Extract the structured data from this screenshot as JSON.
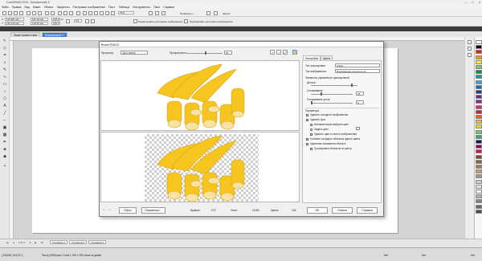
{
  "app": {
    "title": "CorelDRAW 2018 - Безымянный-1*",
    "menu": [
      "Файл",
      "Правка",
      "Вид",
      "Макет",
      "Объект",
      "Эффекты",
      "Растровые изображения",
      "Текст",
      "Таблица",
      "Инструменты",
      "Окно",
      "Справка"
    ],
    "zoom": "75%",
    "snap_label": "Привязать к",
    "start_label": "Запуск"
  },
  "toolbar2": {
    "x_label": "X:",
    "x_value": "110,381 мм",
    "y_label": "Y:",
    "y_value": "110,133 мм",
    "w_value": "187,23 мм",
    "h_value": "110,92 мм",
    "scale_w": "100,0",
    "scale_h": "100,0",
    "pct": "%",
    "angle": "0,0",
    "edit_bitmap": "Редактировать растровое изображение",
    "trace_bitmap": "Трассировать растровое изображение"
  },
  "tabs": [
    "Экран приветствия",
    "Безымянный-1*"
  ],
  "dialog": {
    "title": "PowerTRACE",
    "preview_label": "Просмотр:",
    "preview_mode": "До и после",
    "transparency_label": "Прозрачность:",
    "transparency_value": "50",
    "stats": {
      "curves_label": "Кривые:",
      "curves_value": "272",
      "nodes_label": "Узлы:",
      "nodes_value": "11183",
      "colors_label": "Цвета:",
      "colors_value": "134"
    },
    "buttons": {
      "reset": "Сброс",
      "options": "Параметры...",
      "ok": "OK",
      "cancel": "Отмена",
      "help": "Справка"
    },
    "settings": {
      "tabs": [
        "Настройки",
        "Цвета"
      ],
      "trace_type_label": "Тип трассировки:",
      "trace_type_value": "Абрис",
      "image_type_label": "Тип изображения:",
      "image_type_value": "Изображение высокого ка...",
      "controls_header": "Элементы управления трассировкой",
      "detail_label": "Детали",
      "smoothing_label": "Сглаживание",
      "smoothing_value": "25",
      "corner_label": "Сглаживание углов",
      "corner_value": "0",
      "params_header": "Параметры",
      "delete_original": "Удалить исходное изображение",
      "remove_bg": "Удалить фон",
      "auto_color": "Автоматически выбрать цвет",
      "set_color": "Задать цвет",
      "remove_all": "Удалить цвет из всего изображения",
      "merge_adjacent": "Слияние соседних объектов одного цвета",
      "remove_overlap": "Удаление наложения объекта",
      "group_by_color": "Группировка объектов по цвету"
    }
  },
  "pages": [
    "Страница 1",
    "Страница 2",
    "Страница 3"
  ],
  "page_counter": "1 из 1",
  "status": {
    "coords": "(-95,835; 243,071 )",
    "info": "Растр (RGB) вкл. Слой 1 199 x 199 точек на дюйм",
    "fill_none": "Нет",
    "outline_none": "Нет",
    "fill_none2": "Нет"
  },
  "colors": {
    "accent": "#3d7fd6",
    "banana": "#f6c51f",
    "banana_dark": "#d9a215",
    "cut": "#f8e3a4"
  },
  "palette": [
    "#ffffff",
    "#000000",
    "#e31c23",
    "#f7931e",
    "#fcee21",
    "#8cc63f",
    "#009245",
    "#00a99d",
    "#29abe2",
    "#0071bc",
    "#2e3192",
    "#662d91",
    "#93278f",
    "#ed1e79",
    "#c1272d",
    "#f15a24",
    "#fbb03b",
    "#d9e021",
    "#7ac943",
    "#22b573",
    "#1b1464",
    "#9e005d",
    "#d4145a",
    "#754c24",
    "#8c6239",
    "#a67c52",
    "#c69c6d",
    "#999999",
    "#cccccc",
    "#e6e6e6",
    "#f2f2f2",
    "#b3b3b3",
    "#808080",
    "#666666",
    "#4d4d4d"
  ]
}
